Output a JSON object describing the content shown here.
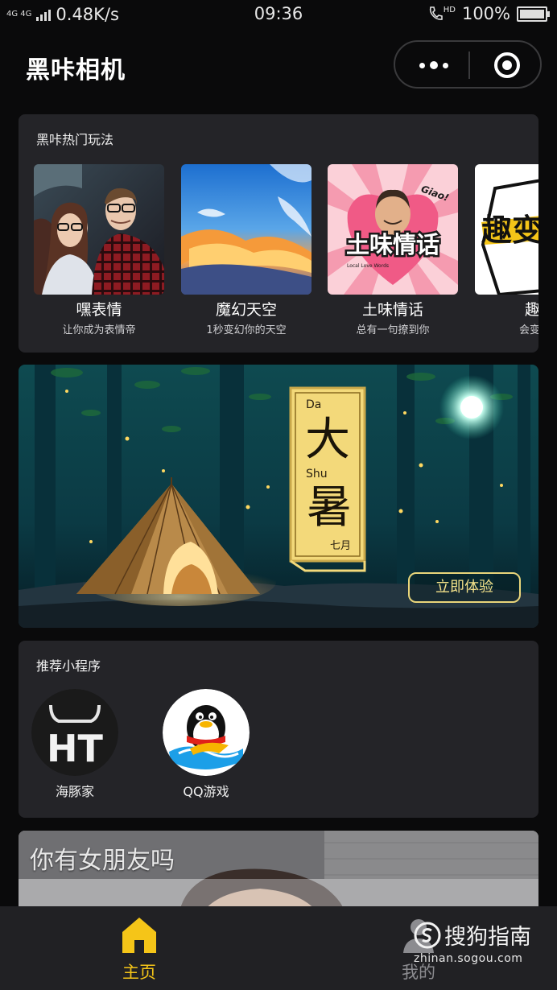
{
  "status_bar": {
    "network_type": "4G 4G",
    "speed": "0.48K/s",
    "time": "09:36",
    "hd": "HD",
    "battery": "100%"
  },
  "nav": {
    "title": "黑咔相机"
  },
  "hot_section": {
    "title": "黑咔热门玩法",
    "items": [
      {
        "name": "嘿表情",
        "desc": "让你成为表情帝"
      },
      {
        "name": "魔幻天空",
        "desc": "1秒变幻你的天空"
      },
      {
        "name": "土味情话",
        "desc": "总有一句撩到你",
        "thumb_text": "土味情话",
        "thumb_small": "Giao!",
        "thumb_caption": "Local Love Words"
      },
      {
        "name": "趣变",
        "desc": "会变声的",
        "thumb_text": "趣变"
      }
    ]
  },
  "banner": {
    "latin_top": "Da",
    "char_top": "大",
    "latin_mid": "Shu",
    "char_bottom": "暑",
    "month": "七月",
    "button": "立即体验"
  },
  "mini_programs": {
    "title": "推荐小程序",
    "items": [
      {
        "name": "海豚家",
        "logo_text": "HT"
      },
      {
        "name": "QQ游戏"
      }
    ]
  },
  "video": {
    "title": "你有女朋友吗"
  },
  "tabbar": {
    "home": "主页",
    "mine": "我的"
  },
  "watermark": {
    "brand": "搜狗指南",
    "url": "zhinan.sogou.com"
  },
  "colors": {
    "accent": "#f5c518",
    "card_bg": "#242428",
    "page_bg": "#0a0a0b",
    "banner_gold": "#e9d57a"
  }
}
